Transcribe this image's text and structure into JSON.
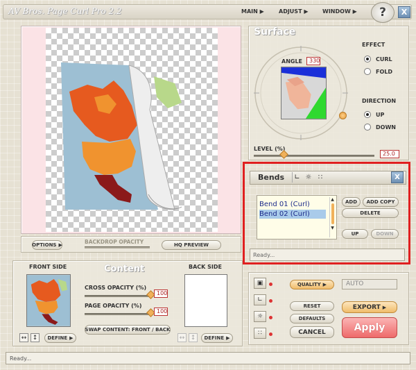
{
  "window": {
    "title": "AV Bros. Page Curl Pro 2.2",
    "close": "X",
    "help": "?"
  },
  "menu": {
    "main": "MAIN",
    "adjust": "ADJUST",
    "window": "WINDOW"
  },
  "preview": {
    "options": "OPTIONS",
    "backdrop_opacity": "BACKDROP OPACITY",
    "hq_preview": "HQ PREVIEW"
  },
  "surface": {
    "title": "Surface",
    "angle_label": "ANGLE",
    "angle_value": "330",
    "level_label": "LEVEL (%)",
    "level_value": "25.0",
    "effect_label": "EFFECT",
    "effect_curl": "CURL",
    "effect_fold": "FOLD",
    "direction_label": "DIRECTION",
    "direction_up": "UP",
    "direction_down": "DOWN"
  },
  "bends": {
    "title": "Bends",
    "close": "X",
    "items": [
      "Bend 01 (Curl)",
      "Bend 02 (Curl)"
    ],
    "selected_index": 1,
    "add": "ADD",
    "add_copy": "ADD COPY",
    "delete": "DELETE",
    "up": "UP",
    "down": "DOWN",
    "status": "Ready..."
  },
  "content": {
    "title": "Content",
    "front_side": "FRONT SIDE",
    "back_side": "BACK SIDE",
    "cross_opacity_label": "CROSS OPACITY (%)",
    "cross_opacity_value": "100",
    "page_opacity_label": "PAGE OPACITY (%)",
    "page_opacity_value": "100",
    "swap": "SWAP CONTENT: FRONT / BACK",
    "define": "DEFINE",
    "cross_opacity_fraction": 1.0,
    "page_opacity_fraction": 1.0
  },
  "actions": {
    "quality": "QUALITY",
    "quality_value": "AUTO",
    "reset": "RESET",
    "defaults": "DEFAULTS",
    "cancel": "CANCEL",
    "export": "EXPORT",
    "apply": "Apply"
  },
  "status_bar": "Ready...",
  "colors": {
    "accent_red": "#e02020",
    "apply_pink": "#f28080",
    "map_sea": "#9dbfd3",
    "map_orange": "#f0932f",
    "map_dark_orange": "#e65a1f",
    "map_maroon": "#8b1a1a"
  }
}
